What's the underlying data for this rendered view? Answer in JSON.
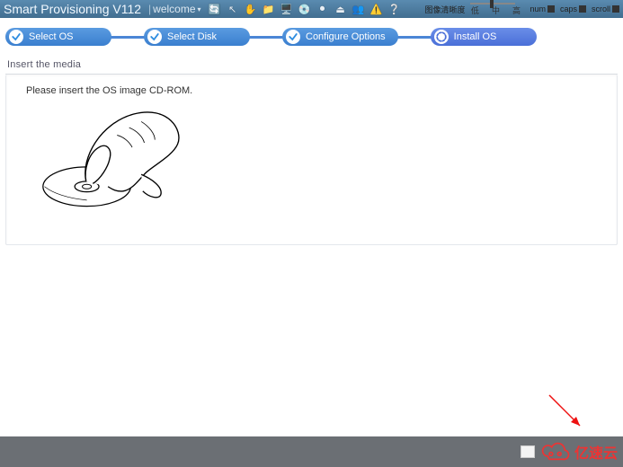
{
  "header": {
    "app_title": "Smart Provisioning V112",
    "welcome_label": "welcome",
    "quality_label": "图像清晰度",
    "quality_low": "低",
    "quality_mid": "中",
    "quality_high": "高",
    "ind_num": "num",
    "ind_caps": "caps",
    "ind_scroll": "scroll"
  },
  "steps": {
    "s1": "Select OS",
    "s2": "Select Disk",
    "s3": "Configure Options",
    "s4": "Install OS"
  },
  "panel": {
    "title": "Insert the media",
    "instruction": "Please insert the OS image CD-ROM."
  },
  "watermark": {
    "text": "亿速云"
  }
}
